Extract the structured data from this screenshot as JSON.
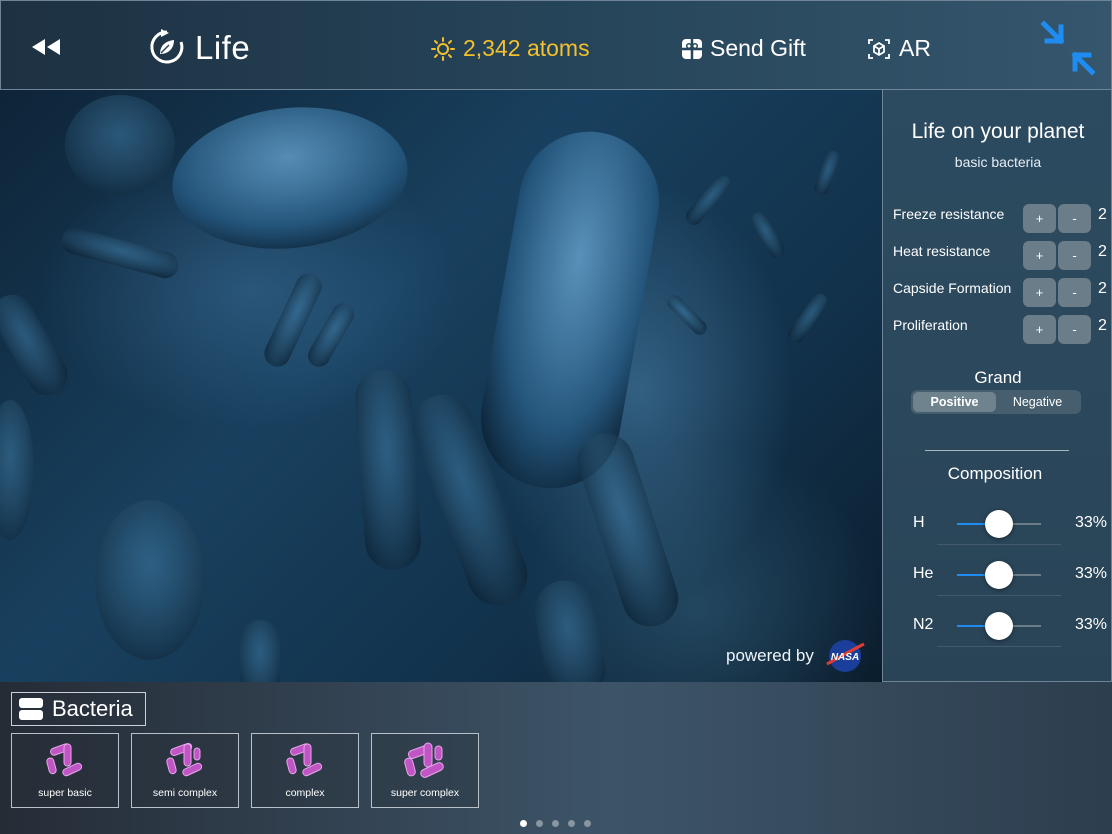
{
  "header": {
    "title": "Life",
    "atoms": "2,342 atoms",
    "send_gift": "Send Gift",
    "ar": "AR",
    "colors": {
      "atoms": "#f3c02b",
      "accent": "#1e8cf0"
    },
    "icons": [
      "rewind-icon",
      "refresh-leaf-icon",
      "sun-icon",
      "gift-icon",
      "ar-cube-icon",
      "collapse-arrows-icon"
    ]
  },
  "viewer": {
    "powered_by": "powered by",
    "logo_text": "NASA"
  },
  "panel": {
    "title": "Life on your planet",
    "subtitle": "basic bacteria",
    "traits": [
      {
        "label": "Freeze resistance",
        "plus": "+",
        "minus": "-",
        "value": "2"
      },
      {
        "label": "Heat resistance",
        "plus": "+",
        "minus": "-",
        "value": "2"
      },
      {
        "label": "Capside Formation",
        "plus": "+",
        "minus": "-",
        "value": "2"
      },
      {
        "label": "Proliferation",
        "plus": "+",
        "minus": "-",
        "value": "2"
      }
    ],
    "grand": {
      "label": "Grand",
      "options": [
        "Positive",
        "Negative"
      ],
      "selected": "Positive"
    },
    "composition": {
      "label": "Composition",
      "items": [
        {
          "name": "H",
          "value": "33%",
          "level": 0.5
        },
        {
          "name": "He",
          "value": "33%",
          "level": 0.5
        },
        {
          "name": "N2",
          "value": "33%",
          "level": 0.5
        }
      ]
    }
  },
  "bottom": {
    "category": "Bacteria",
    "cards": [
      {
        "label": "super basic"
      },
      {
        "label": "semi complex"
      },
      {
        "label": "complex"
      },
      {
        "label": "super complex"
      }
    ],
    "pages": 5,
    "current_page": 1
  }
}
